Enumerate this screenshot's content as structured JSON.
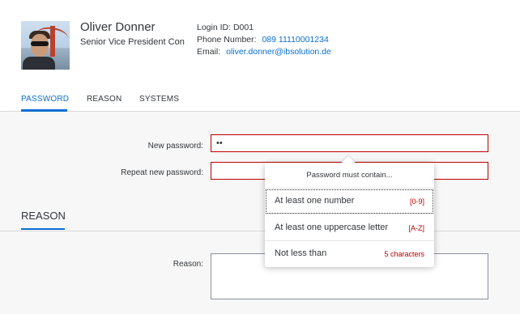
{
  "profile": {
    "name": "Oliver Donner",
    "title": "Senior Vice President Con",
    "login_label": "Login ID:",
    "login_value": "D001",
    "phone_label": "Phone Number:",
    "phone_value": "089 11110001234",
    "email_label": "Email:",
    "email_value": "oliver.donner@ibsolution.de"
  },
  "tabs": [
    {
      "label": "PASSWORD",
      "active": true
    },
    {
      "label": "REASON",
      "active": false
    },
    {
      "label": "SYSTEMS",
      "active": false
    }
  ],
  "form": {
    "new_password_label": "New password:",
    "new_password_value": "••",
    "repeat_password_label": "Repeat new password:",
    "repeat_password_value": "",
    "reason_section_title": "REASON",
    "reason_label": "Reason:",
    "reason_value": ""
  },
  "popover": {
    "header": "Password must contain...",
    "requirements": [
      {
        "text": "At least one number",
        "hint": "[0-9]"
      },
      {
        "text": "At least one uppercase letter",
        "hint": "[A-Z]"
      },
      {
        "text": "Not less than",
        "hint": "5 characters"
      }
    ]
  },
  "colors": {
    "accent": "#0a6ed1",
    "error": "#bb0000"
  }
}
